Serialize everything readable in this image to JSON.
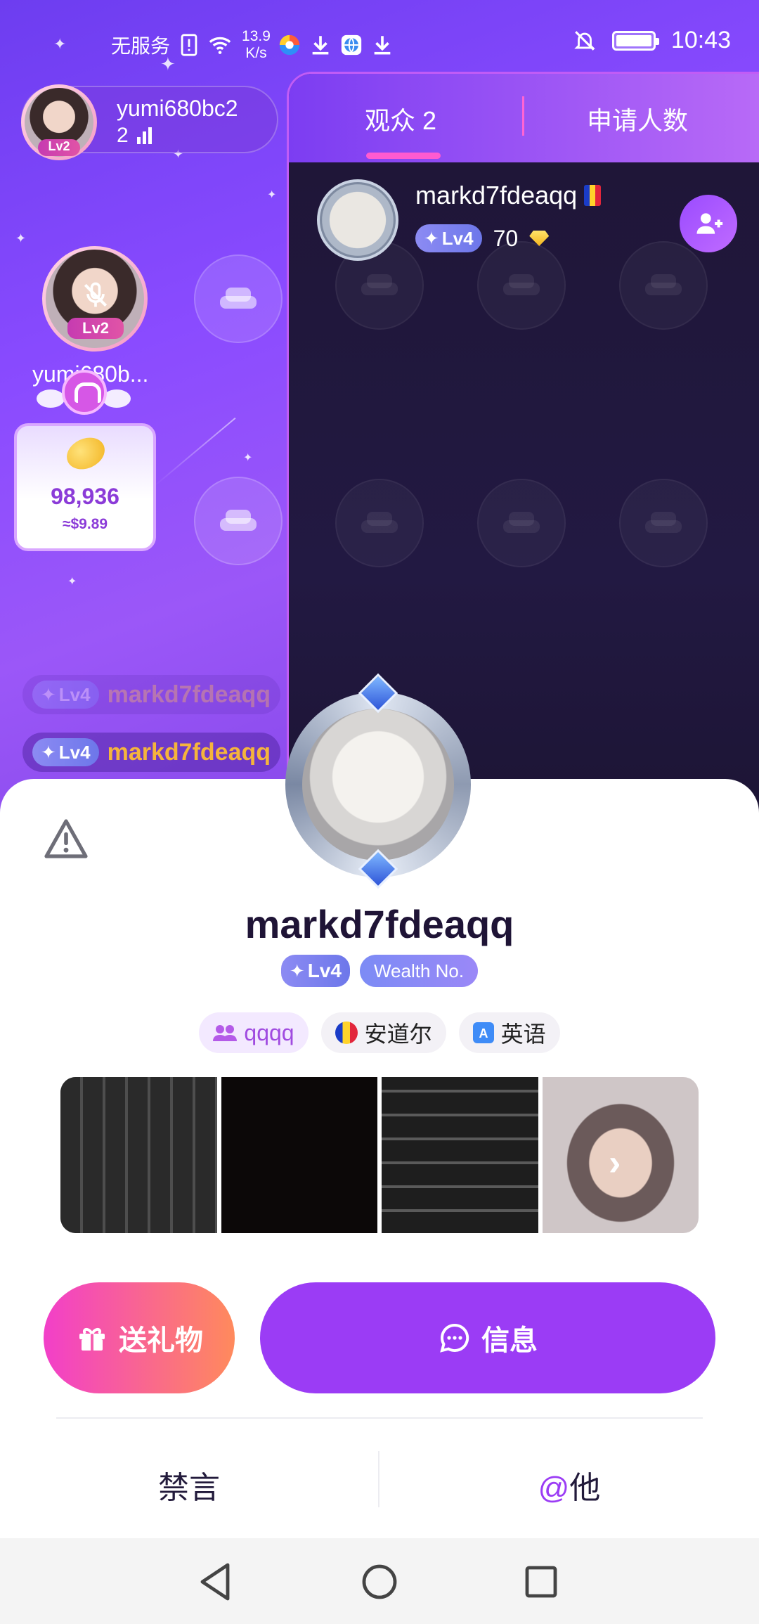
{
  "status_bar": {
    "carrier": "无服务",
    "speed_value": "13.9",
    "speed_unit": "K/s",
    "time": "10:43",
    "battery_level": 1.0
  },
  "host": {
    "name": "yumi680bc2",
    "level": "Lv2",
    "count": "2"
  },
  "guest_seat": {
    "level": "Lv2",
    "name": "yumi680b..."
  },
  "bean_card": {
    "amount": "98,936",
    "usd": "≈$9.89"
  },
  "chat": [
    {
      "level": "Lv4",
      "name": "markd7fdeaqq"
    },
    {
      "level": "Lv4",
      "name": "markd7fdeaqq"
    }
  ],
  "panel": {
    "tabs": [
      {
        "label": "观众 2",
        "active": true
      },
      {
        "label": "申请人数",
        "active": false
      }
    ],
    "audience": [
      {
        "name": "markd7fdeaqq",
        "level": "Lv4",
        "score": "70"
      }
    ]
  },
  "profile": {
    "name": "markd7fdeaqq",
    "level": "Lv4",
    "wealth_label": "Wealth No.",
    "group": "qqqq",
    "country": "安道尔",
    "language": "英语"
  },
  "actions": {
    "gift": "送礼物",
    "message": "信息",
    "mute": "禁言",
    "at_symbol": "@",
    "at_target": "他"
  },
  "colors": {
    "accent_purple": "#9b3cf5",
    "gift_gradient_start": "#f23fc9",
    "gift_gradient_end": "#ff8a5c",
    "chat_name": "#f5b43c"
  }
}
